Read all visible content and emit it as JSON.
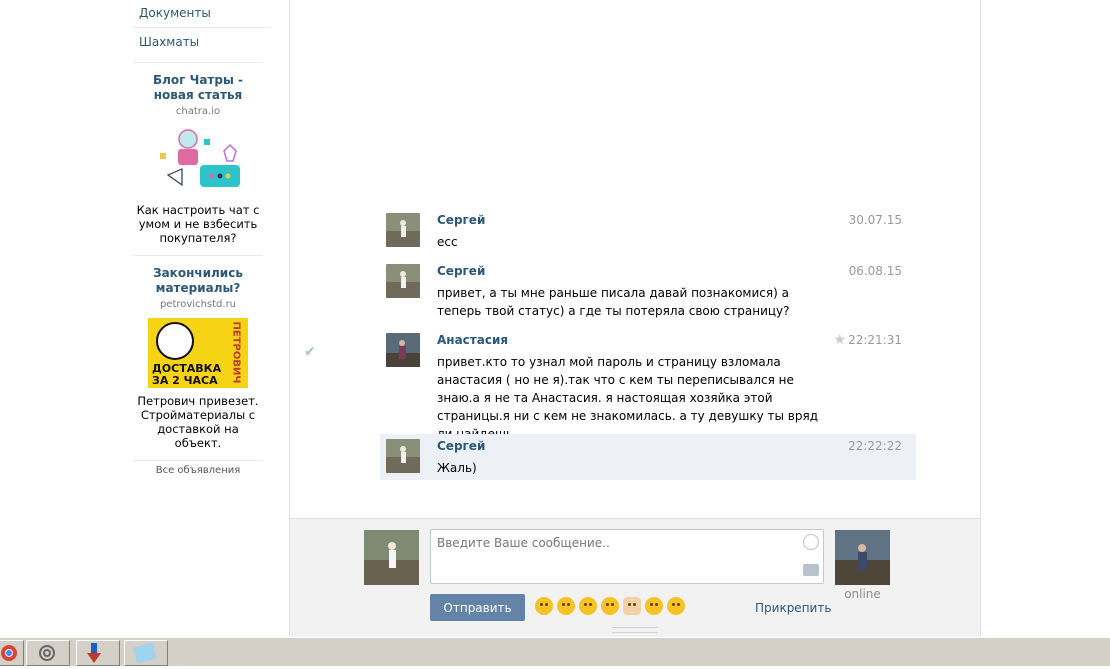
{
  "sidebar": {
    "menu": [
      {
        "label": "Документы"
      },
      {
        "label": "Шахматы"
      }
    ],
    "ads": [
      {
        "title": "Блог Чатры - новая статья",
        "domain": "chatra.io",
        "text": "Как настроить чат с умом и не взбесить покупателя?"
      },
      {
        "title": "Закончились материалы?",
        "domain": "petrovichstd.ru",
        "text": "Петрович привезет. Стройматериалы с доставкой на объект.",
        "image_text_top": "ДОСТАВКА",
        "image_text_bottom": "ЗА 2 ЧАСА",
        "image_brand": "ПЕТРОВИЧ"
      }
    ],
    "all_ads_label": "Все объявления"
  },
  "messages": [
    {
      "author": "Сергей",
      "time": "30.07.15",
      "text": "есс"
    },
    {
      "author": "Сергей",
      "time": "06.08.15",
      "text": "привет, а ты мне раньше писала давай познакомися) а теперь твой статус) а где ты потеряла свою страницу?"
    },
    {
      "author": "Анастасия",
      "time": "22:21:31",
      "text": "привет.кто то узнал мой пароль и страницу взломала анастасия ( но не я).так что с кем ты переписывался не знаю.а я не та Анастасия. я настоящая хозяйка этой страницы.я ни с кем не знакомилась. а ту девушку ты вряд ли найдешь."
    },
    {
      "author": "Сергей",
      "time": "22:22:22",
      "text": "Жаль)"
    }
  ],
  "composer": {
    "placeholder": "Введите Ваше сообщение..",
    "send_label": "Отправить",
    "attach_label": "Прикрепить",
    "online_label": "online"
  },
  "colors": {
    "link": "#2B587A",
    "send_button": "#6383a8",
    "highlight": "#edf1f5"
  }
}
